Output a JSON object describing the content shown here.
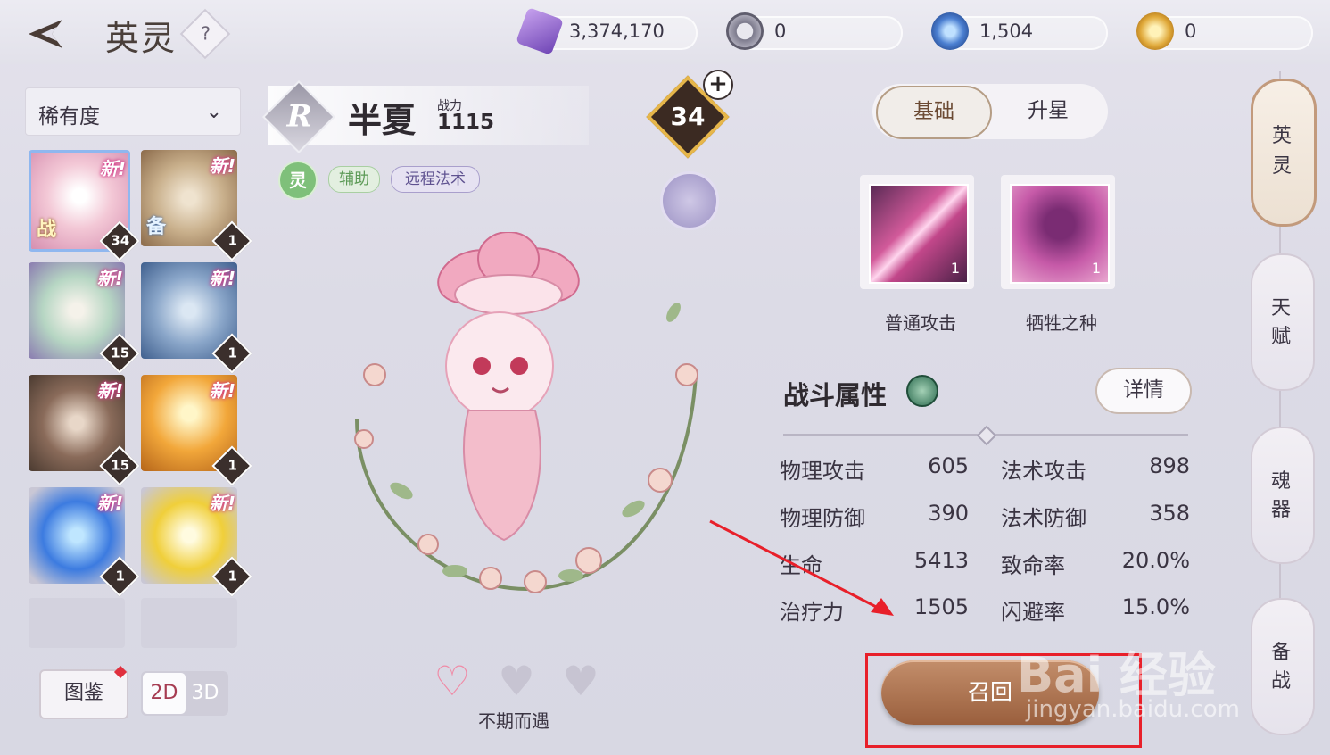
{
  "header": {
    "title": "英灵",
    "help": "?"
  },
  "currencies": [
    {
      "value": "3,374,170",
      "icon": "crystal-icon",
      "color": "#9b6ad6"
    },
    {
      "value": "0",
      "icon": "compass-coin-icon",
      "color": "#7c7a8c"
    },
    {
      "value": "1,504",
      "icon": "blue-spiral-icon",
      "color": "#4b7fd1"
    },
    {
      "value": "0",
      "icon": "gold-coin-icon",
      "color": "#e0a93a"
    }
  ],
  "sidebar": {
    "sort_label": "稀有度",
    "heroes": [
      {
        "new": "新!",
        "tag": "战",
        "level": "34",
        "color": "#f3c8d6"
      },
      {
        "new": "新!",
        "tag": "备",
        "level": "1",
        "color": "#c9b08c"
      },
      {
        "new": "新!",
        "tag": "",
        "level": "15",
        "color": "#b6d6c3"
      },
      {
        "new": "新!",
        "tag": "",
        "level": "1",
        "color": "#8aa6c9"
      },
      {
        "new": "新!",
        "tag": "",
        "level": "15",
        "color": "#8a6b5a"
      },
      {
        "new": "新!",
        "tag": "",
        "level": "1",
        "color": "#f2a73a"
      },
      {
        "new": "新!",
        "tag": "",
        "level": "1",
        "color": "#3c7be0"
      },
      {
        "new": "新!",
        "tag": "",
        "level": "1",
        "color": "#f0cf3a"
      }
    ],
    "codex_label": "图鉴",
    "view_2d": "2D",
    "view_3d": "3D"
  },
  "hero": {
    "rarity": "R",
    "name": "半夏",
    "power_label": "战力",
    "power": "1115",
    "element": "灵",
    "tags": [
      "辅助",
      "远程法术"
    ],
    "level": "34",
    "plus": "+"
  },
  "bond": {
    "label": "不期而遇"
  },
  "panel": {
    "tabs": [
      "基础",
      "升星"
    ],
    "skills": [
      {
        "name": "普通攻击",
        "level": "1"
      },
      {
        "name": "牺牲之种",
        "level": "1"
      }
    ],
    "section_title": "战斗属性",
    "detail_label": "详情",
    "stats": [
      {
        "name": "物理攻击",
        "value": "605"
      },
      {
        "name": "法术攻击",
        "value": "898"
      },
      {
        "name": "物理防御",
        "value": "390"
      },
      {
        "name": "法术防御",
        "value": "358"
      },
      {
        "name": "生命",
        "value": "5413"
      },
      {
        "name": "致命率",
        "value": "20.0%"
      },
      {
        "name": "治疗力",
        "value": "1505"
      },
      {
        "name": "闪避率",
        "value": "15.0%"
      }
    ],
    "recall_label": "召回"
  },
  "sidenav": [
    {
      "l1": "英",
      "l2": "灵"
    },
    {
      "l1": "天",
      "l2": "赋"
    },
    {
      "l1": "魂",
      "l2": "器"
    },
    {
      "l1": "备",
      "l2": "战"
    }
  ],
  "watermark": {
    "main": "Bai 经验",
    "sub": "jingyan.baidu.com"
  }
}
